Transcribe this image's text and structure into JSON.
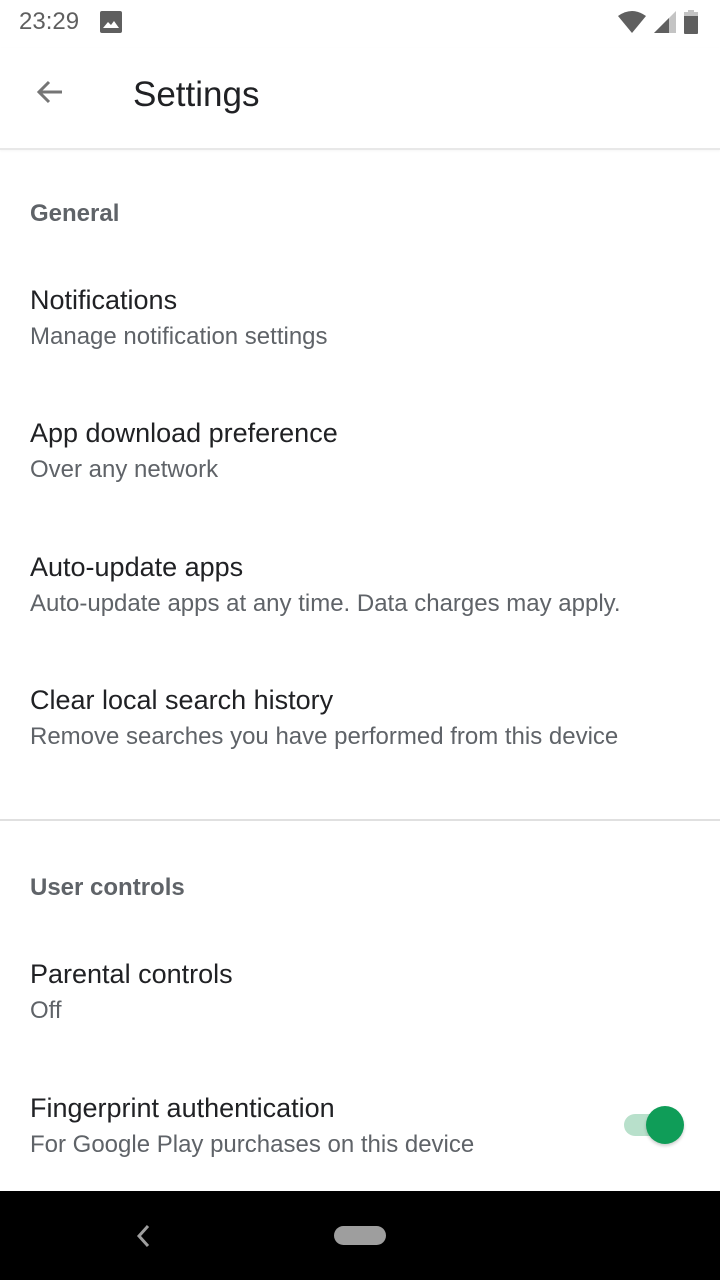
{
  "status_bar": {
    "time": "23:29",
    "icons": [
      "image-icon",
      "wifi-icon",
      "cell-signal-icon",
      "battery-icon"
    ]
  },
  "app_bar": {
    "back_icon": "arrow-back-icon",
    "title": "Settings"
  },
  "sections": [
    {
      "header": "General",
      "items": [
        {
          "title": "Notifications",
          "subtitle": "Manage notification settings"
        },
        {
          "title": "App download preference",
          "subtitle": "Over any network"
        },
        {
          "title": "Auto-update apps",
          "subtitle": "Auto-update apps at any time. Data charges may apply."
        },
        {
          "title": "Clear local search history",
          "subtitle": "Remove searches you have performed from this device"
        }
      ]
    },
    {
      "header": "User controls",
      "items": [
        {
          "title": "Parental controls",
          "subtitle": "Off"
        },
        {
          "title": "Fingerprint authentication",
          "subtitle": "For Google Play purchases on this device",
          "toggle": true
        }
      ]
    }
  ],
  "colors": {
    "accent": "#0f9d58",
    "toggle_track": "#b8e0cb",
    "primary_text": "#202124",
    "secondary_text": "#5f6368"
  },
  "nav_bar": {
    "icons": [
      "nav-back-icon",
      "nav-home-pill"
    ]
  }
}
